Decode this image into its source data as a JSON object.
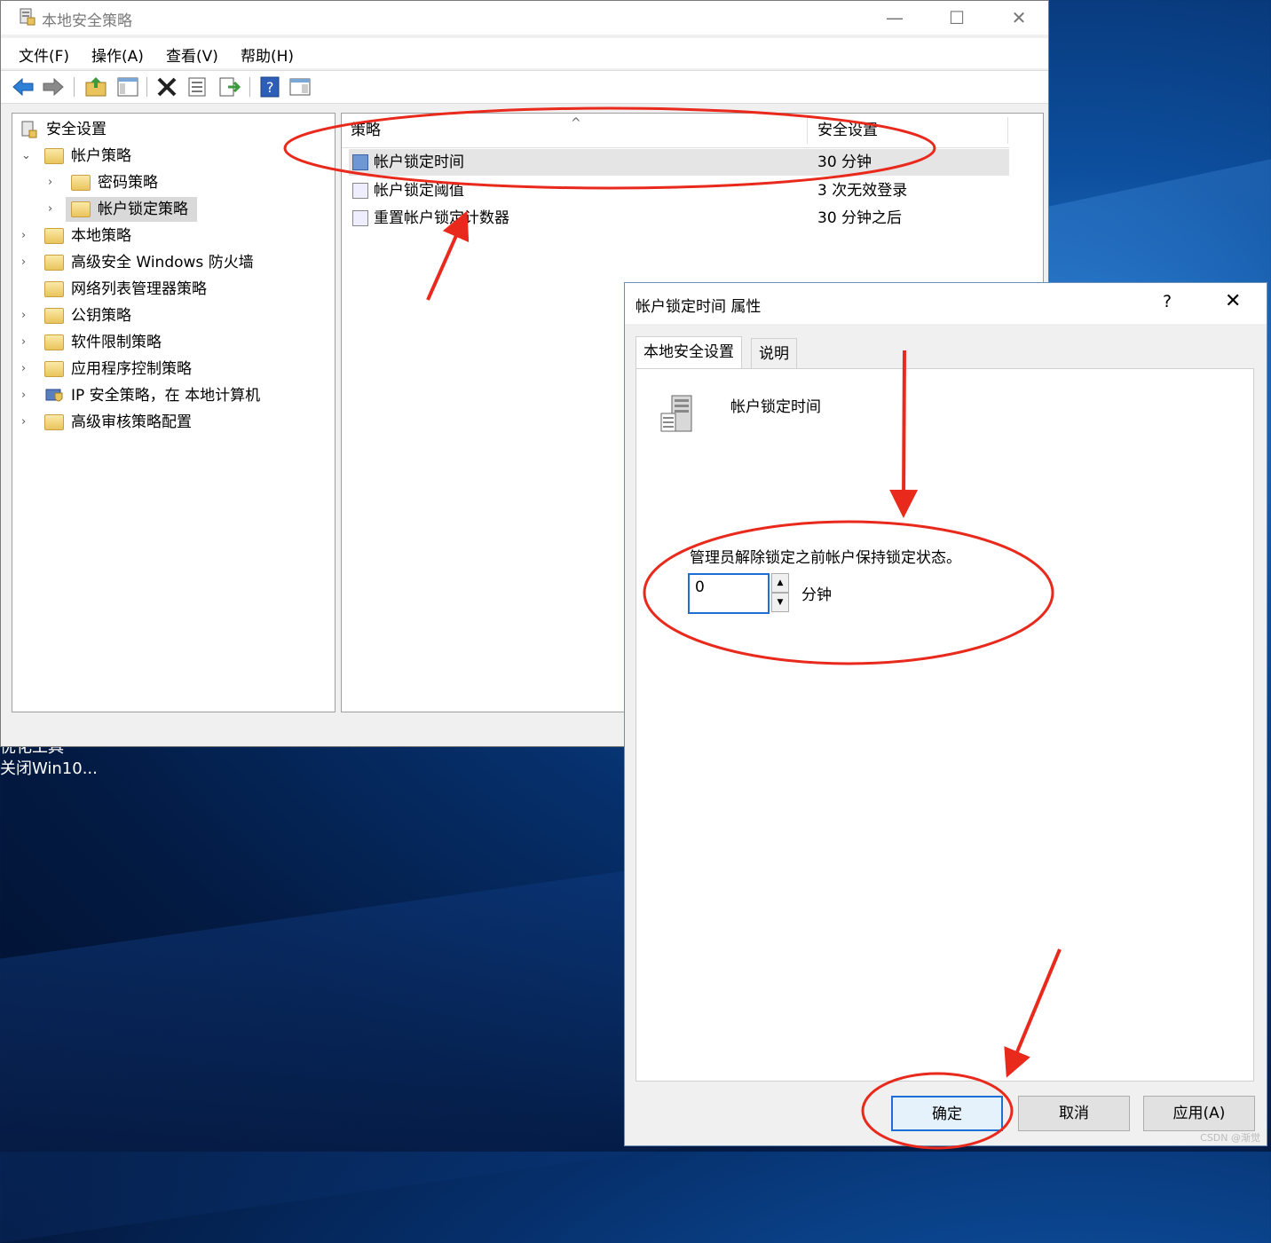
{
  "desktop": {
    "line1": "优化工具",
    "line2": "关闭Win10..."
  },
  "window": {
    "title": "本地安全策略",
    "controls": {
      "minimize": "—",
      "maximize": "☐",
      "close": "✕"
    }
  },
  "menu": {
    "file": "文件(F)",
    "action": "操作(A)",
    "view": "查看(V)",
    "help": "帮助(H)"
  },
  "tree": {
    "root": "安全设置",
    "account_policies": "帐户策略",
    "password_policy": "密码策略",
    "lockout_policy": "帐户锁定策略",
    "local_policies": "本地策略",
    "firewall": "高级安全 Windows 防火墙",
    "network_list": "网络列表管理器策略",
    "public_key": "公钥策略",
    "software_restriction": "软件限制策略",
    "app_control": "应用程序控制策略",
    "ip_security": "IP 安全策略，在 本地计算机",
    "audit": "高级审核策略配置"
  },
  "list": {
    "col_policy": "策略",
    "col_setting": "安全设置",
    "rows": [
      {
        "name": "帐户锁定时间",
        "value": "30 分钟"
      },
      {
        "name": "帐户锁定阈值",
        "value": "3 次无效登录"
      },
      {
        "name": "重置帐户锁定计数器",
        "value": "30 分钟之后"
      }
    ]
  },
  "dialog": {
    "title": "帐户锁定时间 属性",
    "help": "?",
    "close": "✕",
    "tab_local": "本地安全设置",
    "tab_explain": "说明",
    "policy_name": "帐户锁定时间",
    "description": "管理员解除锁定之前帐户保持锁定状态。",
    "value": "0",
    "unit": "分钟",
    "ok": "确定",
    "cancel": "取消",
    "apply": "应用(A)"
  },
  "watermark": "CSDN @渐觉",
  "colors": {
    "annotation": "#e8291c",
    "accent": "#1d6fd6"
  }
}
